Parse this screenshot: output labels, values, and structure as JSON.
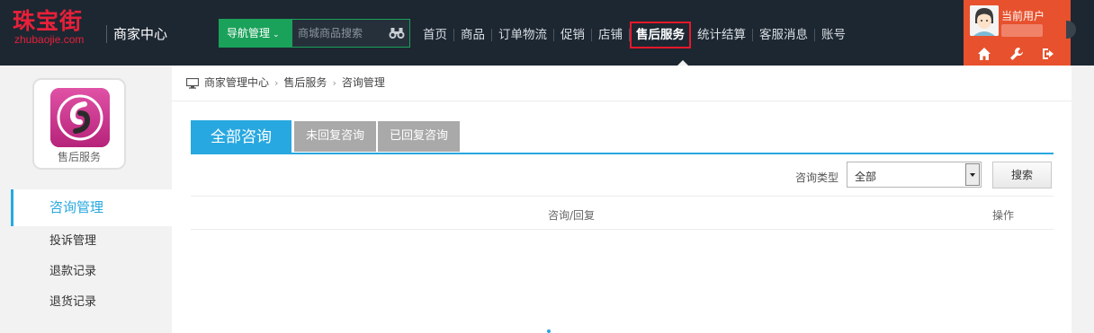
{
  "header": {
    "logo_cn": "珠宝街",
    "logo_en": "zhubaojie.com",
    "center_title": "商家中心",
    "nav_dropdown_label": "导航管理",
    "search_placeholder": "商城商品搜索",
    "menu": [
      {
        "label": "首页"
      },
      {
        "label": "商品"
      },
      {
        "label": "订单物流"
      },
      {
        "label": "促销"
      },
      {
        "label": "店铺"
      },
      {
        "label": "售后服务",
        "active": true
      },
      {
        "label": "统计结算"
      },
      {
        "label": "客服消息"
      },
      {
        "label": "账号"
      }
    ],
    "user_label": "当前用户",
    "user_icons": [
      "home-icon",
      "wrench-icon",
      "logout-icon"
    ],
    "accent_user": "#e7512d"
  },
  "sidebar": {
    "app_label": "售后服务",
    "items": [
      {
        "label": "咨询管理",
        "active": true
      },
      {
        "label": "投诉管理"
      },
      {
        "label": "退款记录"
      },
      {
        "label": "退货记录"
      }
    ]
  },
  "breadcrumb": [
    "商家管理中心",
    "售后服务",
    "咨询管理"
  ],
  "tabs": [
    {
      "label": "全部咨询",
      "active": true
    },
    {
      "label": "未回复咨询"
    },
    {
      "label": "已回复咨询"
    }
  ],
  "filter": {
    "label": "咨询类型",
    "select_value": "全部",
    "search_button": "搜索"
  },
  "table": {
    "columns": [
      "咨询/回复",
      "操作"
    ]
  },
  "colors": {
    "topbar": "#1d2732",
    "primary": "#28a8e0",
    "nav_green": "#1aa15a",
    "active_border": "#e8182a"
  }
}
